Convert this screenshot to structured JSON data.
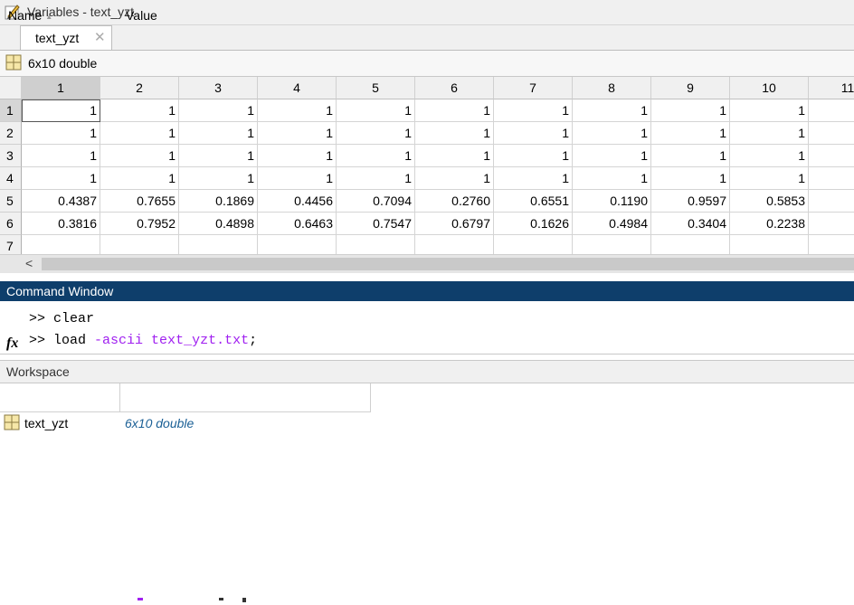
{
  "variables_panel": {
    "title": "Variables - text_yzt",
    "tab_label": "text_yzt",
    "tab_close": "✕",
    "info": "6x10 double"
  },
  "sheet": {
    "column_headers": [
      "1",
      "2",
      "3",
      "4",
      "5",
      "6",
      "7",
      "8",
      "9",
      "10",
      "11"
    ],
    "row_headers": [
      "1",
      "2",
      "3",
      "4",
      "5",
      "6",
      "7"
    ],
    "rows": [
      [
        "1",
        "1",
        "1",
        "1",
        "1",
        "1",
        "1",
        "1",
        "1",
        "1"
      ],
      [
        "1",
        "1",
        "1",
        "1",
        "1",
        "1",
        "1",
        "1",
        "1",
        "1"
      ],
      [
        "1",
        "1",
        "1",
        "1",
        "1",
        "1",
        "1",
        "1",
        "1",
        "1"
      ],
      [
        "1",
        "1",
        "1",
        "1",
        "1",
        "1",
        "1",
        "1",
        "1",
        "1"
      ],
      [
        "0.4387",
        "0.7655",
        "0.1869",
        "0.4456",
        "0.7094",
        "0.2760",
        "0.6551",
        "0.1190",
        "0.9597",
        "0.5853"
      ],
      [
        "0.3816",
        "0.7952",
        "0.4898",
        "0.6463",
        "0.7547",
        "0.6797",
        "0.1626",
        "0.4984",
        "0.3404",
        "0.2238"
      ]
    ],
    "scroll_left_arrow": "<"
  },
  "command_window": {
    "title": "Command Window",
    "lines": [
      {
        "prompt": ">>",
        "cmd": "clear",
        "args": ""
      },
      {
        "prompt": ">>",
        "cmd": "load",
        "args": " -ascii text_yzt.txt",
        "end": ";"
      }
    ],
    "fx_label": "fx"
  },
  "workspace": {
    "title": "Workspace",
    "col_name": "Name",
    "sort_indicator": "▲",
    "col_value": "Value",
    "items": [
      {
        "name": "text_yzt",
        "value": "6x10 double"
      }
    ]
  },
  "colors": {
    "command_title_bg": "#0e3e6b",
    "string_purple": "#a020f0",
    "value_blue": "#1a5f95"
  }
}
